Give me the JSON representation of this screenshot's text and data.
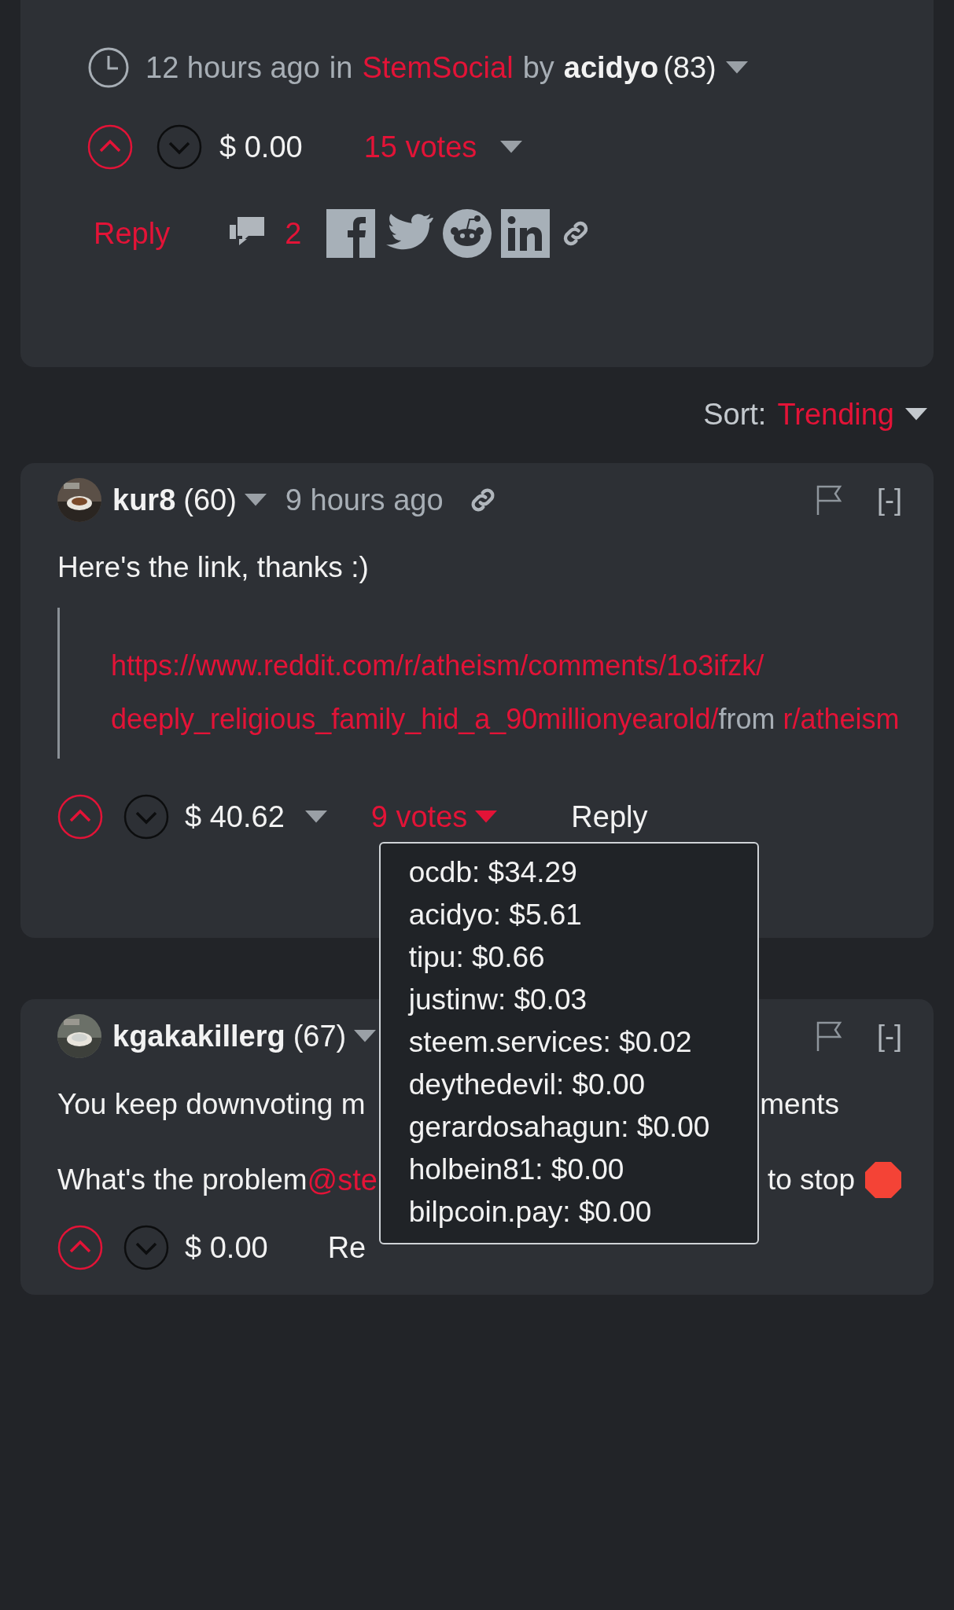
{
  "post": {
    "time": "12 hours ago",
    "in_label": "in",
    "community": "StemSocial",
    "by_label": "by",
    "author": "acidyo",
    "reputation": "(83)",
    "payout": "$ 0.00",
    "votes": "15 votes",
    "reply": "Reply",
    "comment_count": "2"
  },
  "sort": {
    "label": "Sort:",
    "value": "Trending"
  },
  "comments": [
    {
      "author": "kur8",
      "reputation": "(60)",
      "time": "9 hours ago",
      "collapse": "[-]",
      "text": "Here's the link, thanks :)",
      "quote": [
        {
          "kind": "link",
          "text": "https://www.reddit.com/r/atheism/comments/1o3ifzk/"
        },
        {
          "kind": "link",
          "text": "deeply_religious_family_hid_a_90millionyearold/"
        },
        {
          "kind": "plain",
          "text": "from"
        },
        {
          "kind": "link",
          "text": "r/atheism"
        }
      ],
      "payout": "$ 40.62",
      "votes": "9 votes",
      "reply": "Reply",
      "voters": [
        "ocdb: $34.29",
        "acidyo: $5.61",
        "tipu: $0.66",
        "justinw: $0.03",
        "steem.services: $0.02",
        "deythedevil: $0.00",
        "gerardosahagun: $0.00",
        "holbein81: $0.00",
        "bilpcoin.pay: $0.00"
      ]
    },
    {
      "author": "kgakakillerg",
      "reputation": "(67)",
      "collapse": "[-]",
      "line_1": {
        "left": "You keep downvoting m",
        "right": "ments"
      },
      "line_2": {
        "left": "What's the problem ",
        "mention": "@ste",
        "right": "to stop"
      },
      "payout": "$ 0.00",
      "reply": "Re"
    }
  ]
}
